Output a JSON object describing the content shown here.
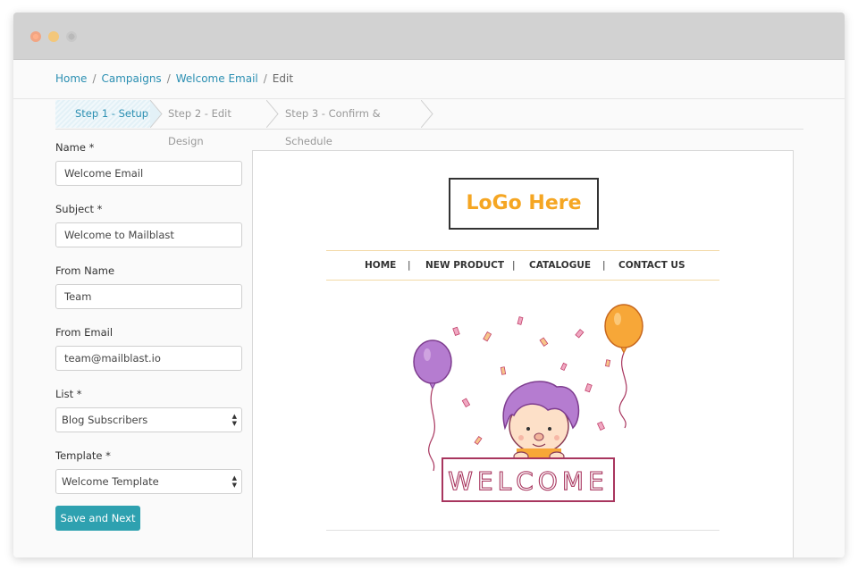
{
  "breadcrumb": {
    "items": [
      "Home",
      "Campaigns",
      "Welcome Email"
    ],
    "current": "Edit",
    "separator": "/"
  },
  "steps": [
    {
      "label": "Step 1 - Setup",
      "active": true
    },
    {
      "label": "Step 2 - Edit Design",
      "active": false
    },
    {
      "label": "Step 3 - Confirm & Schedule",
      "active": false
    }
  ],
  "form": {
    "name": {
      "label": "Name *",
      "value": "Welcome Email"
    },
    "subject": {
      "label": "Subject *",
      "value": "Welcome to Mailblast"
    },
    "from_name": {
      "label": "From Name",
      "value": "Team"
    },
    "from_email": {
      "label": "From Email",
      "value": "team@mailblast.io"
    },
    "list": {
      "label": "List *",
      "value": "Blog Subscribers"
    },
    "template": {
      "label": "Template *",
      "value": "Welcome Template"
    },
    "submit_label": "Save and Next"
  },
  "preview": {
    "logo_text": "LoGo Here",
    "nav": [
      "HOME",
      "NEW PRODUCT",
      "CATALOGUE",
      "CONTACT US"
    ],
    "nav_separator": "|",
    "banner_text": "WELCOME"
  },
  "colors": {
    "link": "#2b8fb2",
    "button": "#2ea1b0",
    "logo": "#f5a623",
    "balloon_purple": "#b57cd0",
    "balloon_orange": "#f7a738",
    "welcome_border": "#a8355e"
  },
  "icons": {
    "window_controls": [
      "close-dot",
      "minimize-dot",
      "maximize-dot"
    ],
    "select_caret": "updown-caret-icon"
  }
}
